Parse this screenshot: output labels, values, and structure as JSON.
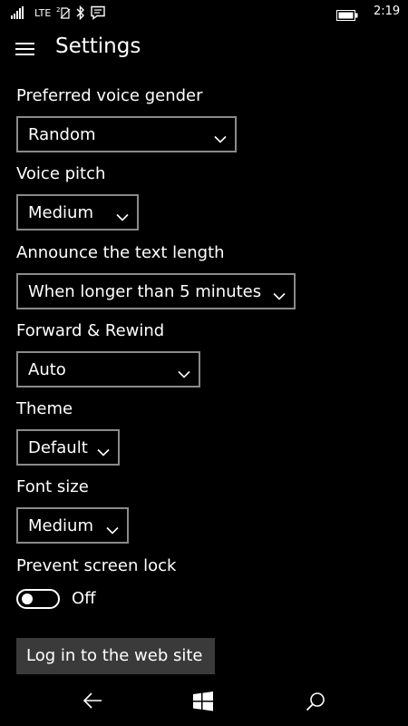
{
  "status_bar": {
    "network": "LTE",
    "time": "2:19",
    "icons": [
      "signal-icon",
      "sim-icon",
      "bluetooth-icon",
      "message-icon",
      "battery-icon"
    ]
  },
  "header": {
    "menu_icon": "hamburger-icon",
    "title": "Settings"
  },
  "settings": {
    "voice_gender": {
      "label": "Preferred voice gender",
      "value": "Random"
    },
    "voice_pitch": {
      "label": "Voice pitch",
      "value": "Medium"
    },
    "text_length": {
      "label": "Announce the text length",
      "value": "When longer than 5 minutes"
    },
    "forward_rewind": {
      "label": "Forward & Rewind",
      "value": "Auto"
    },
    "theme": {
      "label": "Theme",
      "value": "Default"
    },
    "font_size": {
      "label": "Font size",
      "value": "Medium"
    },
    "screen_lock": {
      "label": "Prevent screen lock",
      "state": "Off",
      "checked": false
    }
  },
  "web_button": {
    "label": "Log in to the web site"
  },
  "nav_bar": {
    "icons": [
      "back-icon",
      "windows-icon",
      "search-icon"
    ]
  },
  "colors": {
    "background": "#000000",
    "text": "#ffffff",
    "combo_border": "#8a8a8a",
    "button_bg": "#3a3a3a"
  }
}
